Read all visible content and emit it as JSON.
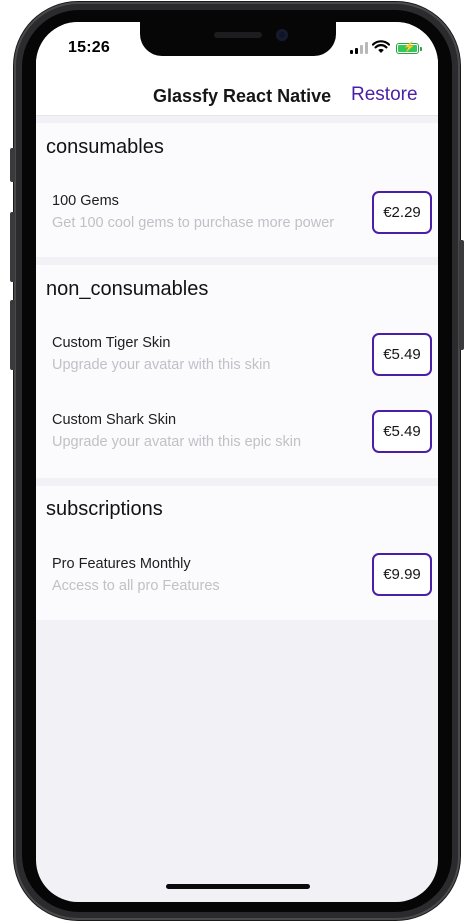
{
  "status_bar": {
    "time": "15:26"
  },
  "header": {
    "title": "Glassfy React Native",
    "restore_label": "Restore"
  },
  "colors": {
    "accent": "#4a1fa8",
    "background": "#f2f1f6",
    "section_bg": "#fbfafd"
  },
  "sections": [
    {
      "title": "consumables",
      "products": [
        {
          "name": "100 Gems",
          "description": "Get 100 cool gems to purchase more power",
          "price": "€2.29"
        }
      ]
    },
    {
      "title": "non_consumables",
      "products": [
        {
          "name": "Custom Tiger Skin",
          "description": "Upgrade your avatar with this skin",
          "price": "€5.49"
        },
        {
          "name": "Custom Shark Skin",
          "description": "Upgrade your avatar with this epic skin",
          "price": "€5.49"
        }
      ]
    },
    {
      "title": "subscriptions",
      "products": [
        {
          "name": "Pro Features Monthly",
          "description": "Access to all pro Features",
          "price": "€9.99"
        }
      ]
    }
  ]
}
